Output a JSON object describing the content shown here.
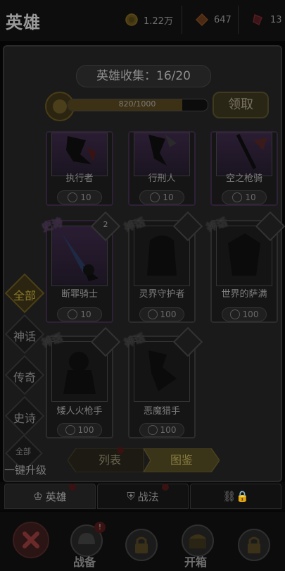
{
  "header": {
    "title": "英雄",
    "resources": [
      {
        "icon": "gold-coin-icon",
        "value": "1.22万"
      },
      {
        "icon": "red-gem-icon",
        "value": "647"
      },
      {
        "icon": "ticket-icon",
        "value": "13"
      }
    ]
  },
  "collection": {
    "title": "英雄收集：16/20",
    "progress_text": "820/1000",
    "progress_fraction": 0.82,
    "claim_label": "领取"
  },
  "cards": [
    {
      "name": "执行者",
      "count": "10",
      "rarity": "",
      "variant": "purple"
    },
    {
      "name": "行刑人",
      "count": "10",
      "rarity": "",
      "variant": "purple"
    },
    {
      "name": "空之枪骑",
      "count": "10",
      "rarity": "",
      "variant": "purple"
    },
    {
      "name": "断罪骑士",
      "count": "10",
      "rarity": "史诗",
      "level": "2",
      "variant": "purple"
    },
    {
      "name": "灵界守护者",
      "count": "100",
      "rarity": "神话",
      "level": "",
      "variant": "dark"
    },
    {
      "name": "世界的萨满",
      "count": "100",
      "rarity": "神话",
      "level": "",
      "variant": "dark"
    },
    {
      "name": "矮人火枪手",
      "count": "100",
      "rarity": "神话",
      "level": "",
      "variant": "dark"
    },
    {
      "name": "恶魔猎手",
      "count": "100",
      "rarity": "神话",
      "level": "",
      "variant": "dark"
    }
  ],
  "filters": [
    {
      "label": "全部",
      "active": true
    },
    {
      "label": "神话",
      "active": false
    },
    {
      "label": "传奇",
      "active": false
    },
    {
      "label": "史诗",
      "active": false
    }
  ],
  "upgrade_all": {
    "icon_label": "全部",
    "label": "一键升级"
  },
  "view_toggle": {
    "list": "列表",
    "gallery": "图鉴"
  },
  "tabs": [
    {
      "label": "英雄",
      "icon": "crown-icon"
    },
    {
      "label": "战法",
      "icon": "shield-icon"
    },
    {
      "label": "",
      "icon": "chain-lock-icon"
    }
  ],
  "nav": {
    "battle": "战备",
    "chest": "开箱",
    "badge": "!"
  }
}
